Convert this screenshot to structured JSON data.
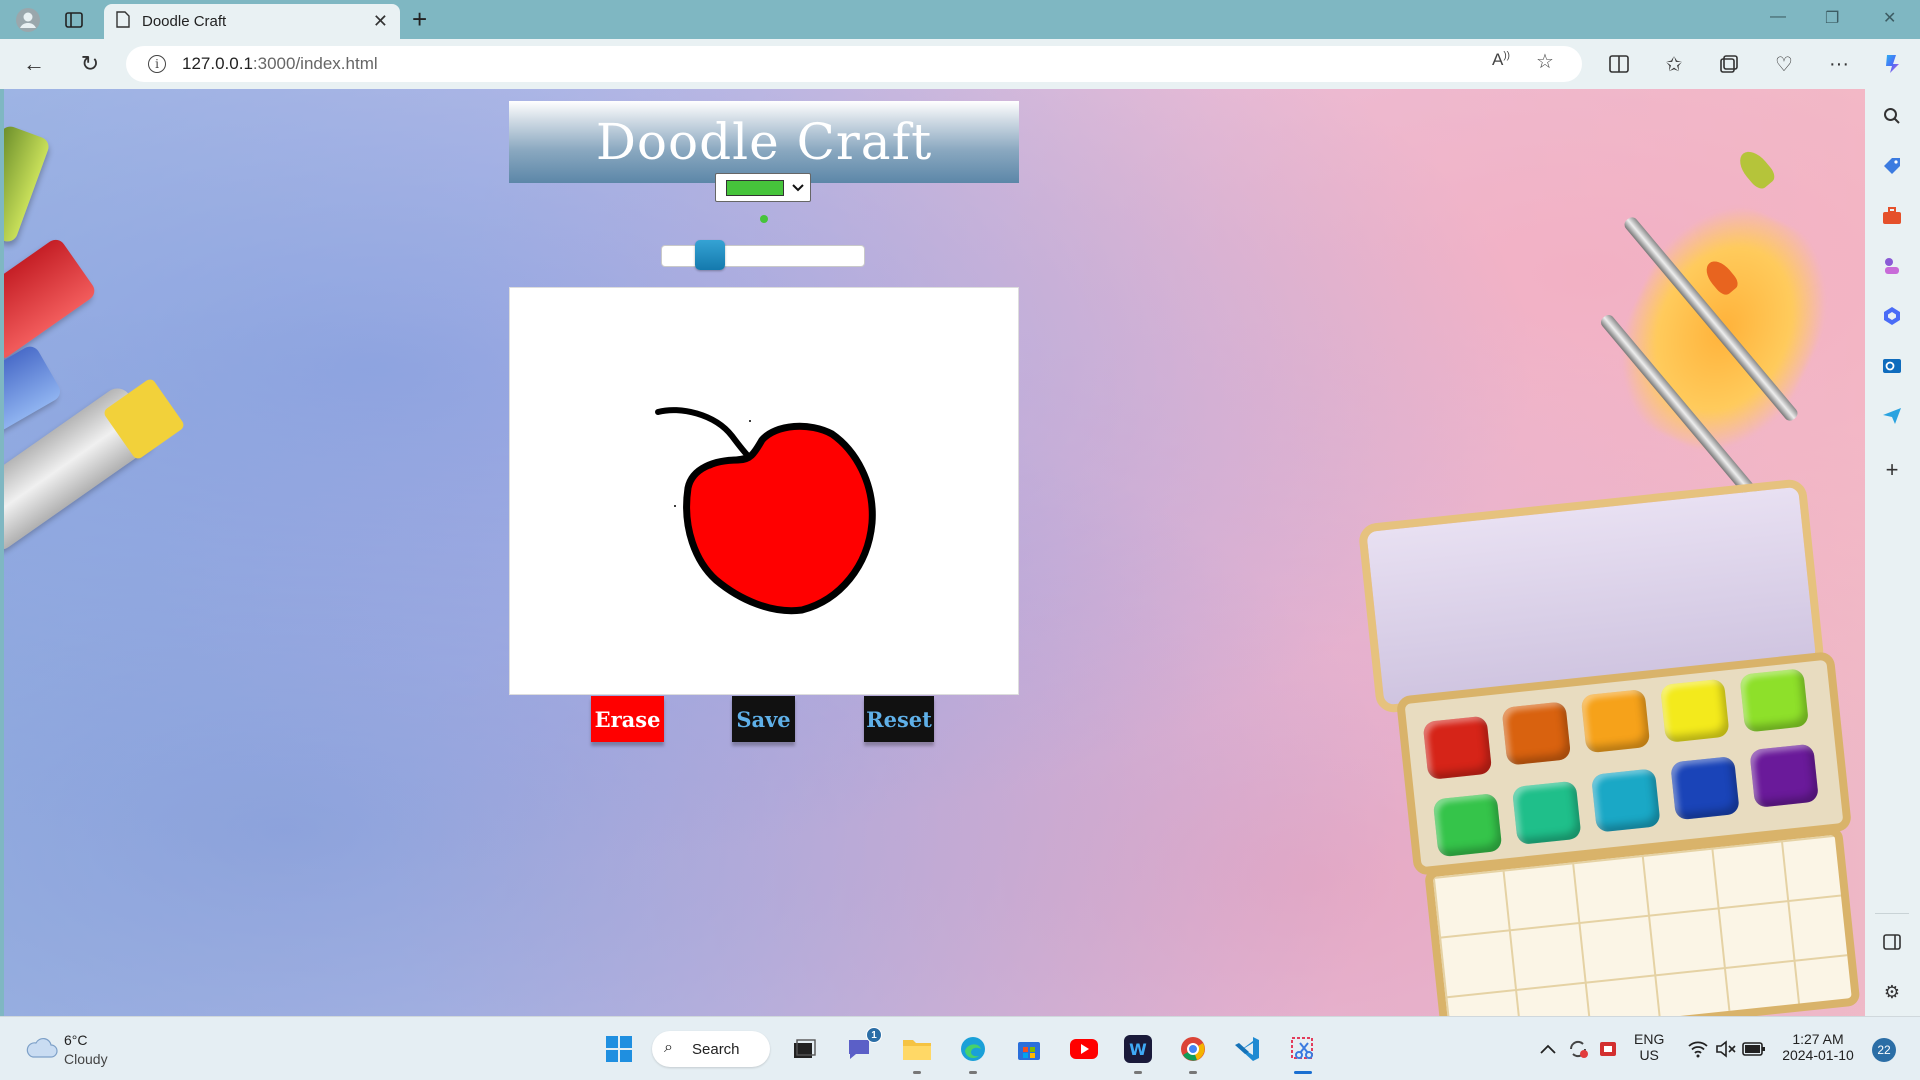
{
  "browser": {
    "tab_title": "Doodle Craft",
    "url_host": "127.0.0.1",
    "url_path": ":3000/index.html"
  },
  "app": {
    "title": "Doodle Craft",
    "selected_color": "#46c43b",
    "brush_size_fraction": 0.19,
    "buttons": {
      "erase": "Erase",
      "save": "Save",
      "reset": "Reset"
    },
    "colors": {
      "erase_bg": "#ff0000",
      "save_reset_bg": "#111111",
      "save_reset_text": "#5fb0e8",
      "header_bottom": "#5c87a8"
    }
  },
  "taskbar": {
    "weather_temp": "6°C",
    "weather_desc": "Cloudy",
    "search_label": "Search",
    "chat_badge": "1",
    "lang_top": "ENG",
    "lang_bottom": "US",
    "time": "1:27 AM",
    "date": "2024-01-10",
    "notification_count": "22"
  }
}
